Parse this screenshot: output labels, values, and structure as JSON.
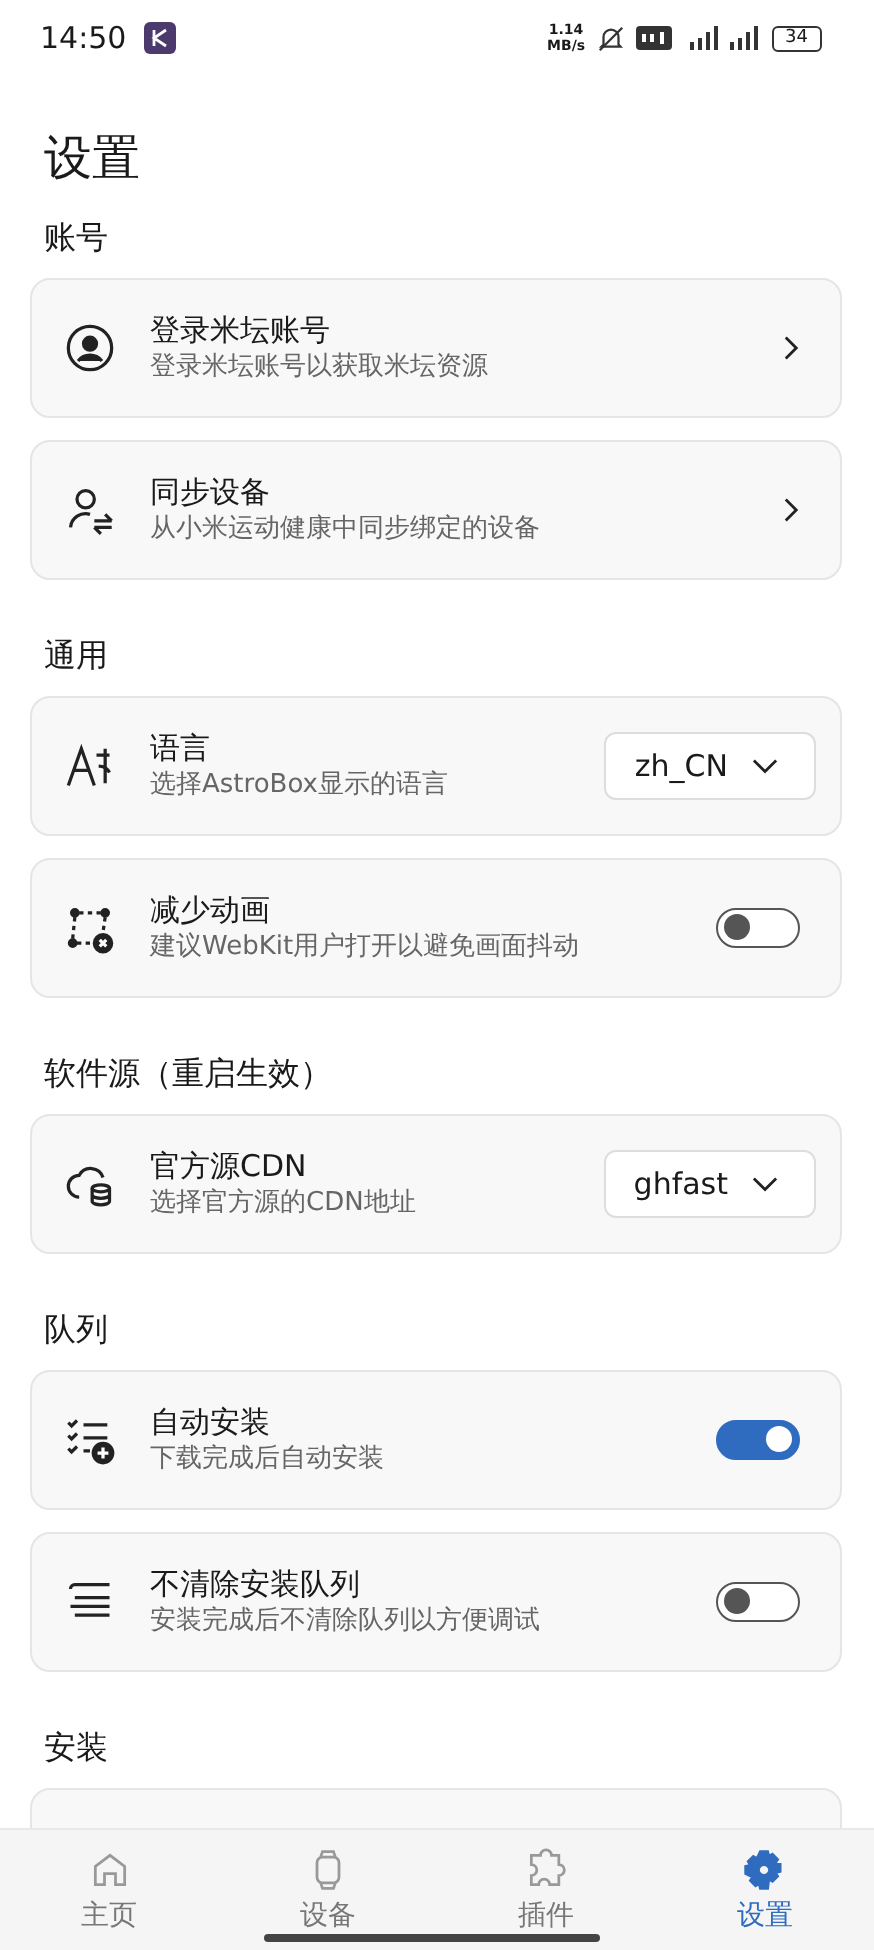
{
  "status_bar": {
    "time": "14:50",
    "speed": "1.14\nMB/s",
    "battery": "34"
  },
  "title": "设置",
  "sections": [
    {
      "title": "账号",
      "items": [
        {
          "kind": "link",
          "title": "登录米坛账号",
          "subtitle": "登录米坛账号以获取米坛资源"
        },
        {
          "kind": "link",
          "title": "同步设备",
          "subtitle": "从小米运动健康中同步绑定的设备"
        }
      ]
    },
    {
      "title": "通用",
      "items": [
        {
          "kind": "select",
          "title": "语言",
          "subtitle": "选择AstroBox显示的语言",
          "value": "zh_CN"
        },
        {
          "kind": "toggle",
          "title": "减少动画",
          "subtitle": "建议WebKit用户打开以避免画面抖动",
          "on": false
        }
      ]
    },
    {
      "title": "软件源（重启生效）",
      "items": [
        {
          "kind": "select",
          "title": "官方源CDN",
          "subtitle": "选择官方源的CDN地址",
          "value": "ghfast"
        }
      ]
    },
    {
      "title": "队列",
      "items": [
        {
          "kind": "toggle",
          "title": "自动安装",
          "subtitle": "下载完成后自动安装",
          "on": true
        },
        {
          "kind": "toggle",
          "title": "不清除安装队列",
          "subtitle": "安装完成后不清除队列以方便调试",
          "on": false
        }
      ]
    },
    {
      "title": "安装"
    }
  ],
  "nav": [
    {
      "label": "主页",
      "selected": false
    },
    {
      "label": "设备",
      "selected": false
    },
    {
      "label": "插件",
      "selected": false
    },
    {
      "label": "设置",
      "selected": true
    }
  ]
}
